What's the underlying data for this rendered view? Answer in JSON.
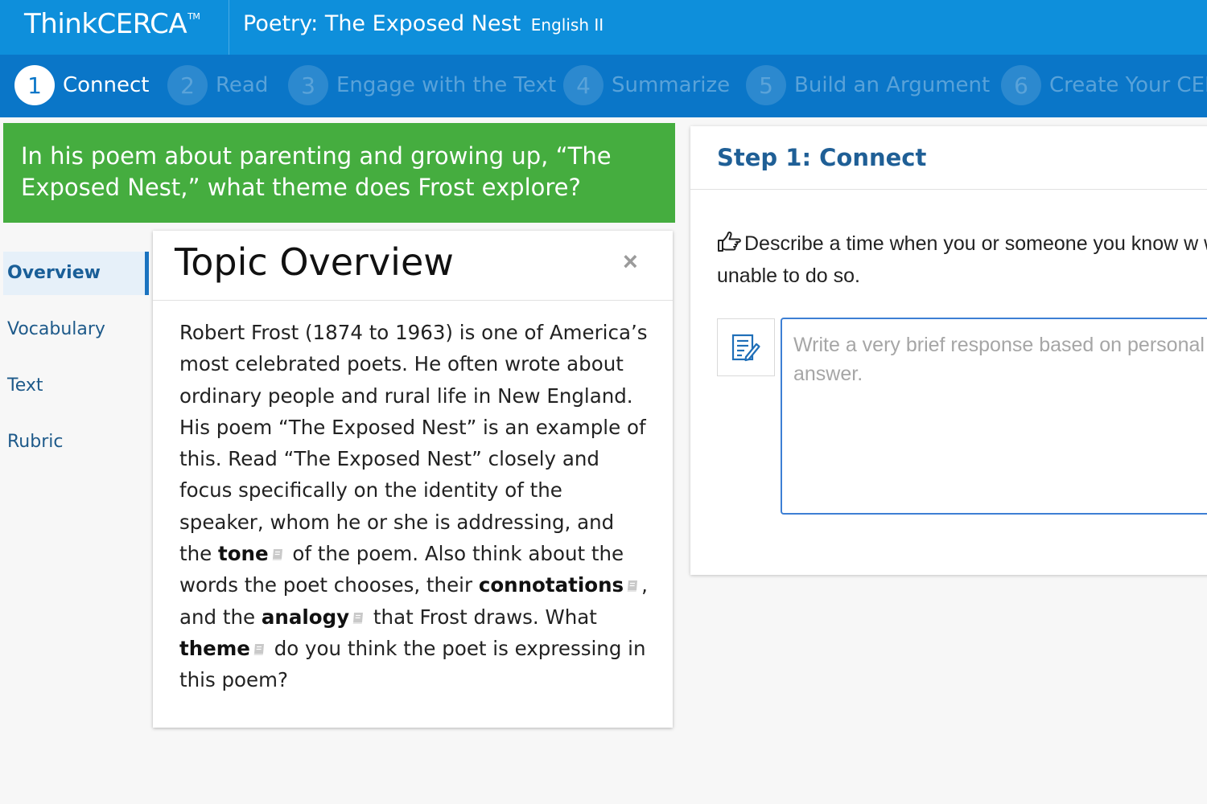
{
  "header": {
    "logo": "ThinkCERCA",
    "logo_tm": "TM",
    "title": "Poetry: The Exposed Nest",
    "subtitle": "English II"
  },
  "steps": [
    {
      "num": "1",
      "label": "Connect",
      "active": true
    },
    {
      "num": "2",
      "label": "Read",
      "active": false
    },
    {
      "num": "3",
      "label": "Engage with the Text",
      "active": false
    },
    {
      "num": "4",
      "label": "Summarize",
      "active": false
    },
    {
      "num": "5",
      "label": "Build an Argument",
      "active": false
    },
    {
      "num": "6",
      "label": "Create Your CER",
      "active": false
    }
  ],
  "question": "In his poem about parenting and growing up, “The Exposed Nest,” what theme does Frost explore?",
  "sidenav": {
    "items": [
      "Overview",
      "Vocabulary",
      "Text",
      "Rubric"
    ],
    "active": "Overview"
  },
  "overview": {
    "title": "Topic Overview",
    "close": "×",
    "text_1": "Robert Frost (1874 to 1963) is one of America’s most celebrated poets. He often wrote about ordinary people and rural life in New England. His poem “The Exposed Nest” is an example of this. Read “The Exposed Nest” closely and focus specifically on the identity of the speaker, whom he or she is addressing, and the ",
    "term_tone": "tone",
    "text_2": " of the poem. Also think about the words the poet chooses, their ",
    "term_connotations": "connotations",
    "text_3": ", and the ",
    "term_analogy": "analogy",
    "text_4": " that Frost draws. What ",
    "term_theme": "theme",
    "text_5": " do you think the poet is expressing in this poem?"
  },
  "panel": {
    "title": "Step 1: Connect",
    "prompt": "Describe a time when you or someone you know w were unable to do so.",
    "response_placeholder": "Write a very brief response based on personal answer."
  },
  "colors": {
    "header": "#0e8fdb",
    "stepnav": "#0a76c8",
    "banner": "#45ad3f",
    "link": "#1e5a8a",
    "panel_title": "#1f5f96",
    "input_border": "#3d7fd4"
  }
}
